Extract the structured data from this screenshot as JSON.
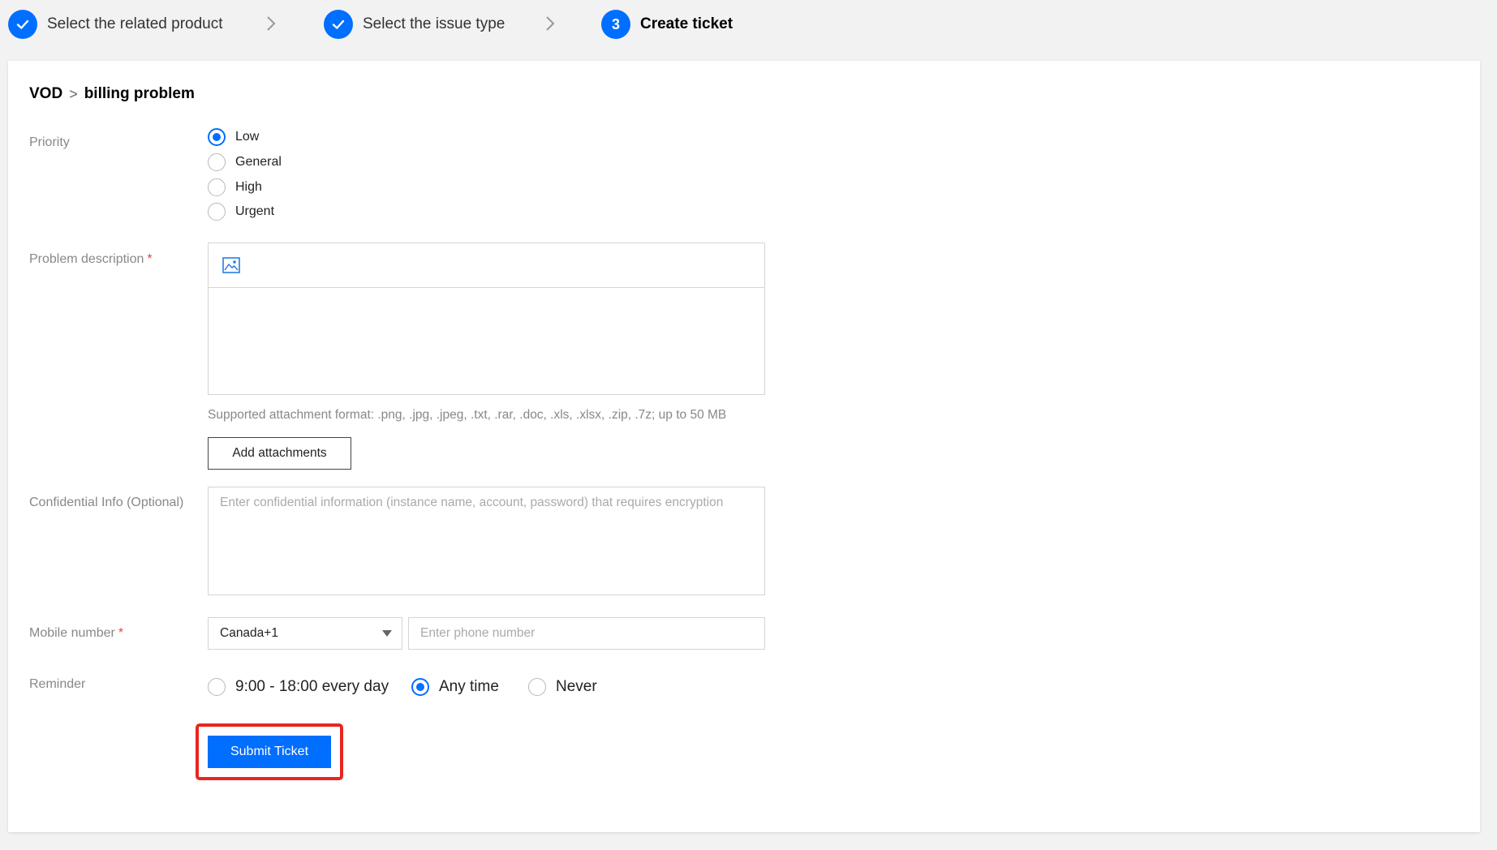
{
  "steps": [
    {
      "label": "Select the related product",
      "state": "done"
    },
    {
      "label": "Select the issue type",
      "state": "done"
    },
    {
      "label": "Create ticket",
      "number": "3",
      "state": "active"
    }
  ],
  "breadcrumb": {
    "product": "VOD",
    "separator": ">",
    "issue": "billing problem"
  },
  "priority": {
    "label": "Priority",
    "options": [
      "Low",
      "General",
      "High",
      "Urgent"
    ],
    "selected": "Low"
  },
  "description": {
    "label": "Problem description",
    "required_mark": "*",
    "toolbar_icon": "image-icon",
    "hint": "Supported attachment format: .png, .jpg, .jpeg, .txt, .rar, .doc, .xls, .xlsx, .zip, .7z; up to 50 MB",
    "attach_button": "Add attachments"
  },
  "confidential": {
    "label": "Confidential Info (Optional)",
    "placeholder": "Enter confidential information (instance name, account, password) that requires encryption"
  },
  "mobile": {
    "label": "Mobile number",
    "required_mark": "*",
    "country_value": "Canada+1",
    "phone_placeholder": "Enter phone number"
  },
  "reminder": {
    "label": "Reminder",
    "options": [
      "9:00 - 18:00 every day",
      "Any time",
      "Never"
    ],
    "selected": "Any time"
  },
  "submit_label": "Submit Ticket",
  "colors": {
    "accent": "#006eff",
    "highlight": "#e8261f",
    "required": "#e54545"
  }
}
